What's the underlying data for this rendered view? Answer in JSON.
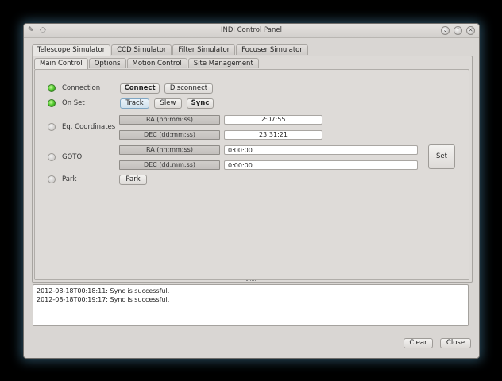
{
  "window": {
    "title": "INDI Control Panel",
    "left_icons": [
      "✎",
      "◌"
    ],
    "controls": [
      "chevron-down",
      "chevron-up",
      "close"
    ]
  },
  "device_tabs": [
    {
      "label": "Telescope Simulator",
      "active": true
    },
    {
      "label": "CCD Simulator",
      "active": false
    },
    {
      "label": "Filter Simulator",
      "active": false
    },
    {
      "label": "Focuser Simulator",
      "active": false
    }
  ],
  "group_tabs": [
    {
      "label": "Main Control",
      "active": true
    },
    {
      "label": "Options",
      "active": false
    },
    {
      "label": "Motion Control",
      "active": false
    },
    {
      "label": "Site Management",
      "active": false
    }
  ],
  "properties": {
    "connection": {
      "label": "Connection",
      "state": "ok",
      "connect": "Connect",
      "disconnect": "Disconnect"
    },
    "on_set": {
      "label": "On Set",
      "state": "ok",
      "track": "Track",
      "slew": "Slew",
      "sync": "Sync"
    },
    "eq_coordinates": {
      "label": "Eq. Coordinates",
      "state": "idle",
      "ra_label": "RA (hh:mm:ss)",
      "ra_value": "2:07:55",
      "dec_label": "DEC (dd:mm:ss)",
      "dec_value": "23:31:21"
    },
    "goto": {
      "label": "GOTO",
      "state": "idle",
      "ra_label": "RA (hh:mm:ss)",
      "ra_value": "0:00:00",
      "dec_label": "DEC (dd:mm:ss)",
      "dec_value": "0:00:00",
      "set": "Set"
    },
    "park": {
      "label": "Park",
      "state": "idle",
      "park": "Park"
    }
  },
  "log": {
    "lines": [
      "2012-08-18T00:18:11: Sync is successful.",
      "2012-08-18T00:19:17: Sync is successful."
    ]
  },
  "footer": {
    "clear": "Clear",
    "close": "Close"
  },
  "colors": {
    "led_ok": "#4cc42a",
    "led_idle": "#c2bfbc",
    "window_bg": "#d9d6d3"
  }
}
